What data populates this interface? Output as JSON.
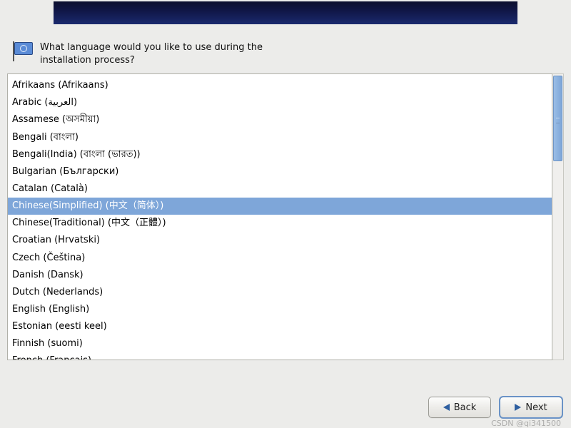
{
  "prompt": "What language would you like to use during the installation process?",
  "languages": [
    {
      "label": "Afrikaans (Afrikaans)",
      "selected": false
    },
    {
      "label": "Arabic (العربية)",
      "selected": false
    },
    {
      "label": "Assamese (অসমীয়া)",
      "selected": false
    },
    {
      "label": "Bengali (বাংলা)",
      "selected": false
    },
    {
      "label": "Bengali(India) (বাংলা (ভারত))",
      "selected": false
    },
    {
      "label": "Bulgarian (Български)",
      "selected": false
    },
    {
      "label": "Catalan (Català)",
      "selected": false
    },
    {
      "label": "Chinese(Simplified) (中文（简体）)",
      "selected": true
    },
    {
      "label": "Chinese(Traditional) (中文（正體）)",
      "selected": false
    },
    {
      "label": "Croatian (Hrvatski)",
      "selected": false
    },
    {
      "label": "Czech (Čeština)",
      "selected": false
    },
    {
      "label": "Danish (Dansk)",
      "selected": false
    },
    {
      "label": "Dutch (Nederlands)",
      "selected": false
    },
    {
      "label": "English (English)",
      "selected": false
    },
    {
      "label": "Estonian (eesti keel)",
      "selected": false
    },
    {
      "label": "Finnish (suomi)",
      "selected": false
    },
    {
      "label": "French (Français)",
      "selected": false
    }
  ],
  "buttons": {
    "back": "Back",
    "next": "Next"
  },
  "watermark": "CSDN @qi341500"
}
